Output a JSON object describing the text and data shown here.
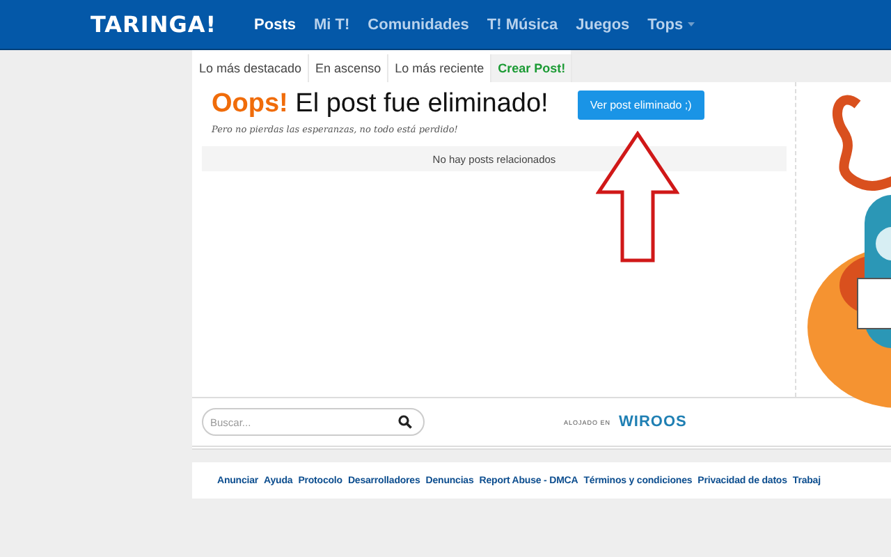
{
  "header": {
    "logo": "TARINGA!",
    "nav": [
      {
        "label": "Posts",
        "selected": true
      },
      {
        "label": "Mi T!",
        "selected": false
      },
      {
        "label": "Comunidades",
        "selected": false
      },
      {
        "label": "T! Música",
        "selected": false
      },
      {
        "label": "Juegos",
        "selected": false
      },
      {
        "label": "Tops",
        "selected": false,
        "dropdown": true
      }
    ]
  },
  "tabs": [
    {
      "label": "Lo más destacado",
      "kind": "tab"
    },
    {
      "label": "En ascenso",
      "kind": "tab"
    },
    {
      "label": "Lo más reciente",
      "kind": "tab"
    },
    {
      "label": "Crear Post!",
      "kind": "create"
    }
  ],
  "notice": {
    "oops": "Oops!",
    "title": "El post fue eliminado!",
    "subtitle": "Pero no pierdas las esperanzas, no todo está perdido!",
    "button": "Ver post eliminado ;)"
  },
  "related": "No hay posts relacionados",
  "search": {
    "placeholder": "Buscar..."
  },
  "hosting": {
    "label": "ALOJADO EN",
    "brand": "WIROOS"
  },
  "footer_links": [
    "Anunciar",
    "Ayuda",
    "Protocolo",
    "Desarrolladores",
    "Denuncias",
    "Report Abuse - DMCA",
    "Términos y condiciones",
    "Privacidad de datos",
    "Trabaj"
  ]
}
